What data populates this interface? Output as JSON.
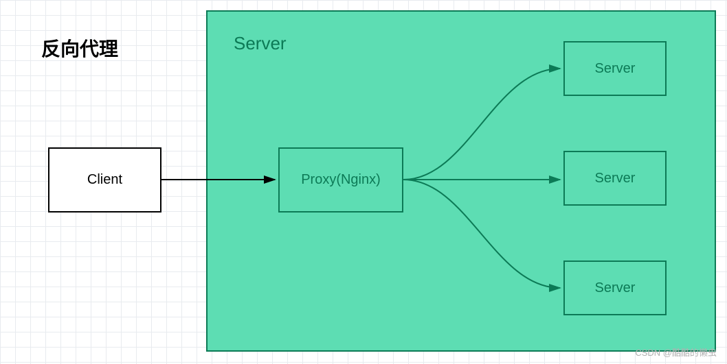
{
  "title": "反向代理",
  "container_label": "Server",
  "nodes": {
    "client": "Client",
    "proxy": "Proxy(Nginx)",
    "server1": "Server",
    "server2": "Server",
    "server3": "Server"
  },
  "watermark": "CSDN @酷酷的懒虫",
  "colors": {
    "container_fill": "#5dddb3",
    "container_stroke": "#0c7a56",
    "text_green": "#0c7a56",
    "grid": "#e8ebef"
  },
  "chart_data": {
    "type": "diagram",
    "title": "反向代理",
    "description": "Reverse proxy architecture diagram",
    "nodes": [
      {
        "id": "client",
        "label": "Client",
        "group": null
      },
      {
        "id": "proxy",
        "label": "Proxy(Nginx)",
        "group": "Server"
      },
      {
        "id": "server1",
        "label": "Server",
        "group": "Server"
      },
      {
        "id": "server2",
        "label": "Server",
        "group": "Server"
      },
      {
        "id": "server3",
        "label": "Server",
        "group": "Server"
      }
    ],
    "groups": [
      {
        "id": "Server",
        "label": "Server"
      }
    ],
    "edges": [
      {
        "from": "client",
        "to": "proxy"
      },
      {
        "from": "proxy",
        "to": "server1"
      },
      {
        "from": "proxy",
        "to": "server2"
      },
      {
        "from": "proxy",
        "to": "server3"
      }
    ]
  }
}
